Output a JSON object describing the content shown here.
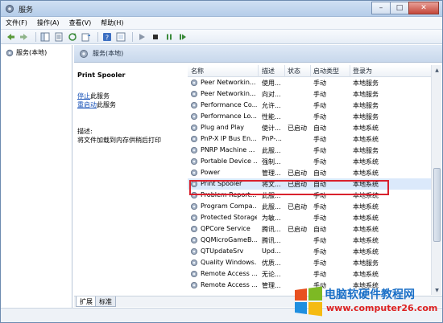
{
  "window": {
    "title": "服务",
    "buttons": {
      "minimize": "–",
      "maximize": "□",
      "close": "✕"
    }
  },
  "menu": [
    "文件(F)",
    "操作(A)",
    "查看(V)",
    "帮助(H)"
  ],
  "toolbar_icons": [
    "back-arrow-icon",
    "forward-arrow-icon",
    "console-tree-icon",
    "properties-icon",
    "refresh-icon",
    "export-icon",
    "help-icon",
    "view-icon",
    "play-icon",
    "stop-icon",
    "pause-icon",
    "restart-icon"
  ],
  "tree": {
    "root_label": "服务(本地)"
  },
  "pane": {
    "header": "服务(本地)"
  },
  "description": {
    "service_name": "Print Spooler",
    "stop_link": "停止",
    "stop_suffix": "此服务",
    "restart_link": "重启动",
    "restart_suffix": "此服务",
    "desc_label": "描述:",
    "desc_text": "将文件加载到内存供稍后打印"
  },
  "table": {
    "columns": [
      "名称",
      "描述",
      "状态",
      "启动类型",
      "登录为"
    ],
    "rows": [
      [
        "Peer Networkin...",
        "使用...",
        "",
        "手动",
        "本地服务"
      ],
      [
        "Peer Networkin...",
        "向对...",
        "",
        "手动",
        "本地服务"
      ],
      [
        "Performance Co...",
        "允许...",
        "",
        "手动",
        "本地服务"
      ],
      [
        "Performance Lo...",
        "性能...",
        "",
        "手动",
        "本地服务"
      ],
      [
        "Plug and Play",
        "使计...",
        "已启动",
        "自动",
        "本地系统"
      ],
      [
        "PnP-X IP Bus En...",
        "PnP-...",
        "",
        "手动",
        "本地系统"
      ],
      [
        "PNRP Machine ...",
        "此服...",
        "",
        "手动",
        "本地服务"
      ],
      [
        "Portable Device ...",
        "强制...",
        "",
        "手动",
        "本地系统"
      ],
      [
        "Power",
        "管理...",
        "已启动",
        "自动",
        "本地系统"
      ],
      [
        "Print Spooler",
        "将文...",
        "已启动",
        "自动",
        "本地系统"
      ],
      [
        "Problem Report...",
        "此服...",
        "",
        "手动",
        "本地系统"
      ],
      [
        "Program Compa...",
        "此服...",
        "已启动",
        "手动",
        "本地系统"
      ],
      [
        "Protected Storage",
        "为敏...",
        "",
        "手动",
        "本地系统"
      ],
      [
        "QPCore Service",
        "腾讯...",
        "已启动",
        "自动",
        "本地系统"
      ],
      [
        "QQMicroGameB...",
        "腾讯...",
        "",
        "手动",
        "本地系统"
      ],
      [
        "QTUpdateSrv",
        "Upd...",
        "",
        "手动",
        "本地系统"
      ],
      [
        "Quality Windows...",
        "优质...",
        "",
        "手动",
        "本地服务"
      ],
      [
        "Remote Access ...",
        "无论...",
        "",
        "手动",
        "本地系统"
      ],
      [
        "Remote Access ...",
        "管理...",
        "",
        "手动",
        "本地系统"
      ]
    ],
    "selected_index": 9
  },
  "tabs": [
    "扩展",
    "标准"
  ],
  "watermark": {
    "line1": "电脑软硬件教程网",
    "line2": "www.computer26.com"
  },
  "colors": {
    "selection_outline": "#d9212d",
    "link": "#1a53b8"
  }
}
